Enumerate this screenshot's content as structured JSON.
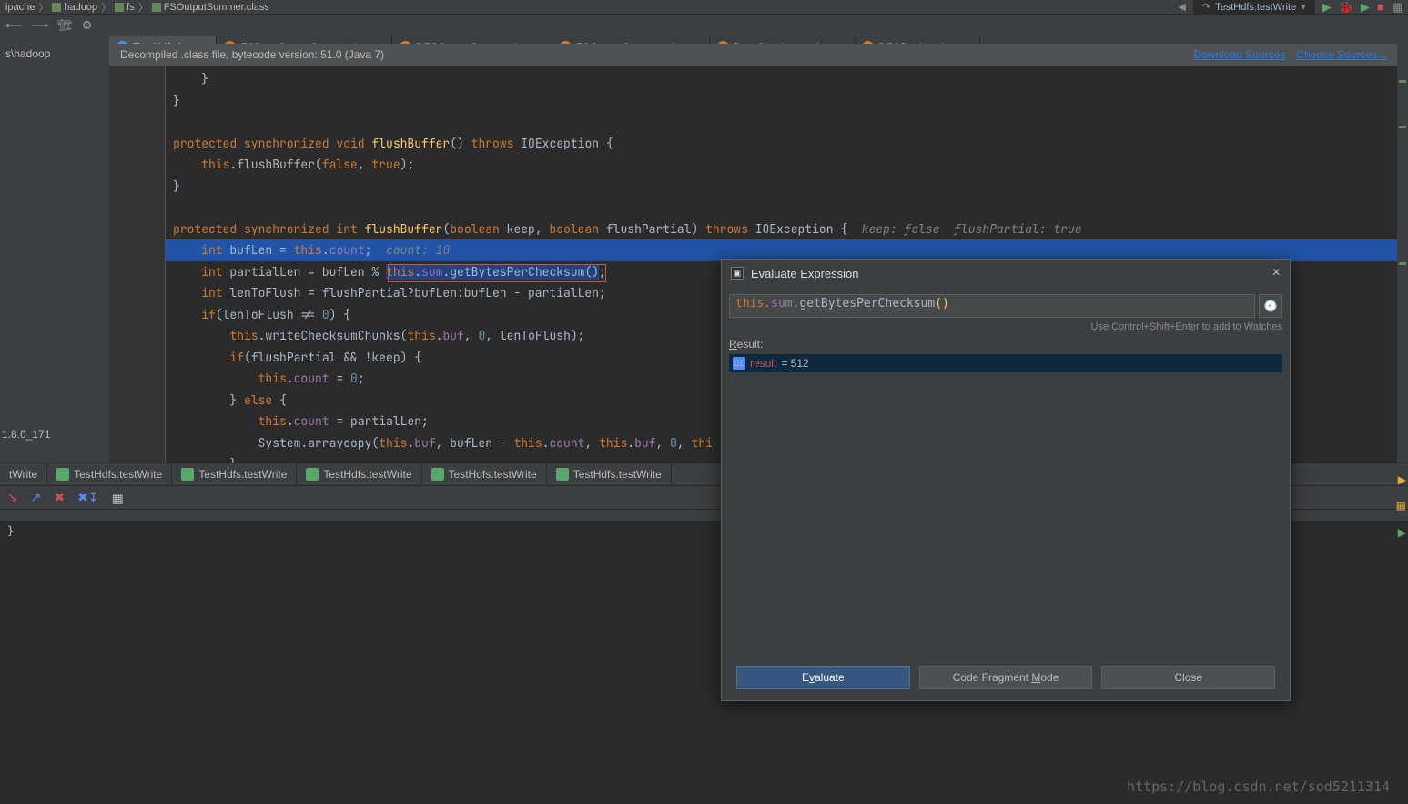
{
  "breadcrumbs": [
    "ipache",
    "hadoop",
    "fs",
    "FSOutputSummer.class"
  ],
  "run_config": "TestHdfs.testWrite",
  "tabs": [
    {
      "label": "TestHdfs.java",
      "icon": "C",
      "active": true
    },
    {
      "label": "FSDataOutputStream.class",
      "icon": "f",
      "active": false
    },
    {
      "label": "DFSOutputStream.class",
      "icon": "f",
      "active": false
    },
    {
      "label": "FSOutputSummer.class",
      "icon": "f",
      "active": false
    },
    {
      "label": "DataChecksum.class",
      "icon": "f",
      "active": false
    },
    {
      "label": "DFSPacket.class",
      "icon": "f",
      "active": false
    }
  ],
  "banner": {
    "text": "Decompiled .class file, bytecode version: 51.0 (Java 7)",
    "link1": "Download Sources",
    "link2": "Choose Sources..."
  },
  "sidebar": {
    "path": "s\\hadoop",
    "jdk": "1.8.0_171"
  },
  "run_tabs": [
    "tWrite",
    "TestHdfs.testWrite",
    "TestHdfs.testWrite",
    "TestHdfs.testWrite",
    "TestHdfs.testWrite",
    "TestHdfs.testWrite"
  ],
  "console_prompt": "}",
  "popup": {
    "title": "Evaluate Expression",
    "expr_this": "this.",
    "expr_field": "sum.",
    "expr_method": "getBytesPerChecksum",
    "expr_par": "()",
    "hint": "Use Control+Shift+Enter to add to Watches",
    "result_label": "Result:",
    "result_name": "result",
    "result_value": "= 512",
    "btn_eval": "Evaluate",
    "btn_mode": "Code Fragment Mode",
    "btn_close": "Close"
  },
  "watermark": "https://blog.csdn.net/sod5211314",
  "code": {
    "inline_hint_count": "count: 10",
    "inline_hint_params": "keep: false  flushPartial: true"
  }
}
